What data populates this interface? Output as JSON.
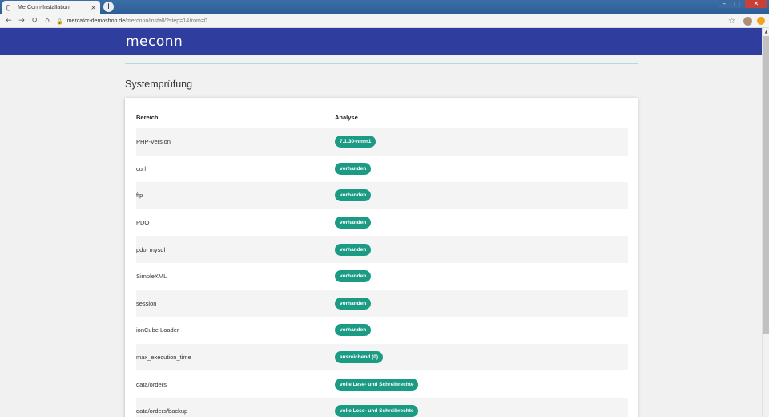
{
  "browser": {
    "tab_title": "MerConn-Installation",
    "tab_close": "×",
    "new_tab": "+",
    "url_host": "mercator-demoshop.de",
    "url_path": "/merconn/install/?step=1&from=0",
    "icons": {
      "back": "←",
      "forward": "→",
      "reload": "↻",
      "home": "⌂",
      "lock": "🔒",
      "star": "☆"
    },
    "window_controls": {
      "minimize": "–",
      "maximize": "□",
      "close": "✕"
    }
  },
  "page": {
    "logo": "meconn",
    "section_title": "Systemprüfung",
    "accent_color": "#2f3e9e",
    "badge_color": "#1c9b84",
    "table": {
      "headers": {
        "area": "Bereich",
        "analysis": "Analyse"
      },
      "rows": [
        {
          "area": "PHP-Version",
          "analysis": "7.1.30-nmm1"
        },
        {
          "area": "curl",
          "analysis": "vorhanden"
        },
        {
          "area": "ftp",
          "analysis": "vorhanden"
        },
        {
          "area": "PDO",
          "analysis": "vorhanden"
        },
        {
          "area": "pdo_mysql",
          "analysis": "vorhanden"
        },
        {
          "area": "SimpleXML",
          "analysis": "vorhanden"
        },
        {
          "area": "session",
          "analysis": "vorhanden"
        },
        {
          "area": "ionCube Loader",
          "analysis": "vorhanden"
        },
        {
          "area": "max_execution_time",
          "analysis": "ausreichend (0)"
        },
        {
          "area": "data/orders",
          "analysis": "volle Lese- und Schreibrechte"
        },
        {
          "area": "data/orders/backup",
          "analysis": "volle Lese- und Schreibrechte"
        }
      ]
    }
  }
}
